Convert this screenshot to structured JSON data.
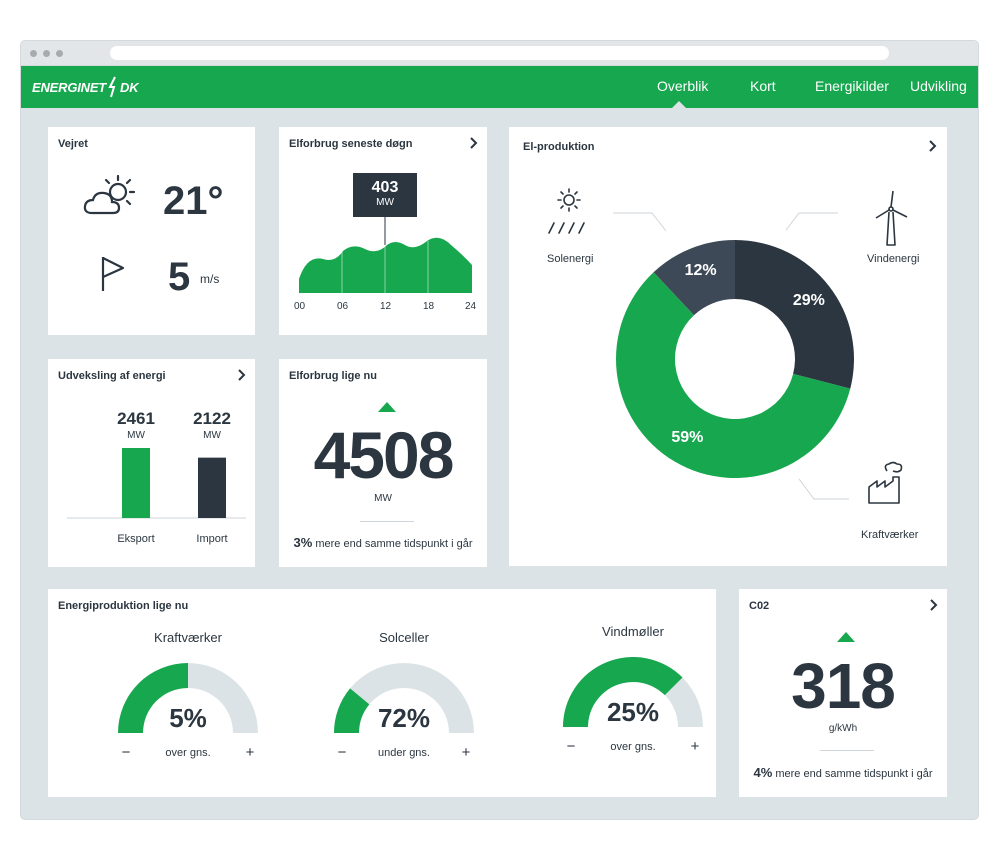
{
  "nav": {
    "logo_left": "ENERGINET",
    "logo_right": "DK",
    "items": [
      "Overblik",
      "Kort",
      "Energikilder",
      "Udvikling"
    ]
  },
  "weather": {
    "title": "Vejret",
    "temperature": "21°",
    "wind_speed": "5",
    "wind_unit": "m/s"
  },
  "consumption_day": {
    "title": "Elforbrug seneste døgn",
    "tooltip_value": "403",
    "tooltip_unit": "MW",
    "x_ticks": [
      "00",
      "06",
      "12",
      "18",
      "24"
    ]
  },
  "production": {
    "title": "El-produktion",
    "labels": {
      "solar": "Solenergi",
      "wind": "Vindenergi",
      "power": "Kraftværker"
    },
    "chart_data": {
      "type": "pie",
      "series": [
        {
          "name": "Solenergi",
          "value": 12,
          "label": "12%",
          "color": "#3e4957"
        },
        {
          "name": "Vindenergi",
          "value": 29,
          "label": "29%",
          "color": "#2b3640"
        },
        {
          "name": "Kraftværker",
          "value": 59,
          "label": "59%",
          "color": "#17a74f"
        }
      ]
    }
  },
  "exchange": {
    "title": "Udveksling af energi",
    "chart_data": {
      "type": "bar",
      "categories": [
        "Eksport",
        "Import"
      ],
      "values": [
        2461,
        2122
      ],
      "value_labels": [
        "2461",
        "2122"
      ],
      "unit": "MW",
      "colors": [
        "#17a74f",
        "#2b3640"
      ]
    }
  },
  "consumption_now": {
    "title": "Elforbrug lige nu",
    "value": "4508",
    "unit": "MW",
    "change_pct": "3%",
    "change_text": "mere end samme tidspunkt i går"
  },
  "energy_now": {
    "title": "Energiproduktion  lige nu",
    "gauges": [
      {
        "name": "Kraftværker",
        "label": "5%",
        "fraction": 0.5,
        "note": "over gns.",
        "minus": "−",
        "plus": "+"
      },
      {
        "name": "Solceller",
        "label": "72%",
        "fraction": 0.22,
        "note": "under gns.",
        "minus": "−",
        "plus": "+"
      },
      {
        "name": "Vindmøller",
        "label": "25%",
        "fraction": 0.75,
        "note": "over gns.",
        "minus": "−",
        "plus": "+"
      }
    ]
  },
  "co2": {
    "title": "C02",
    "value": "318",
    "unit": "g/kWh",
    "change_pct": "4%",
    "change_text": "mere end samme tidspunkt i går"
  },
  "colors": {
    "green": "#17a74f",
    "dark": "#2b3640",
    "slate": "#3e4957",
    "track": "#dce3e6"
  }
}
